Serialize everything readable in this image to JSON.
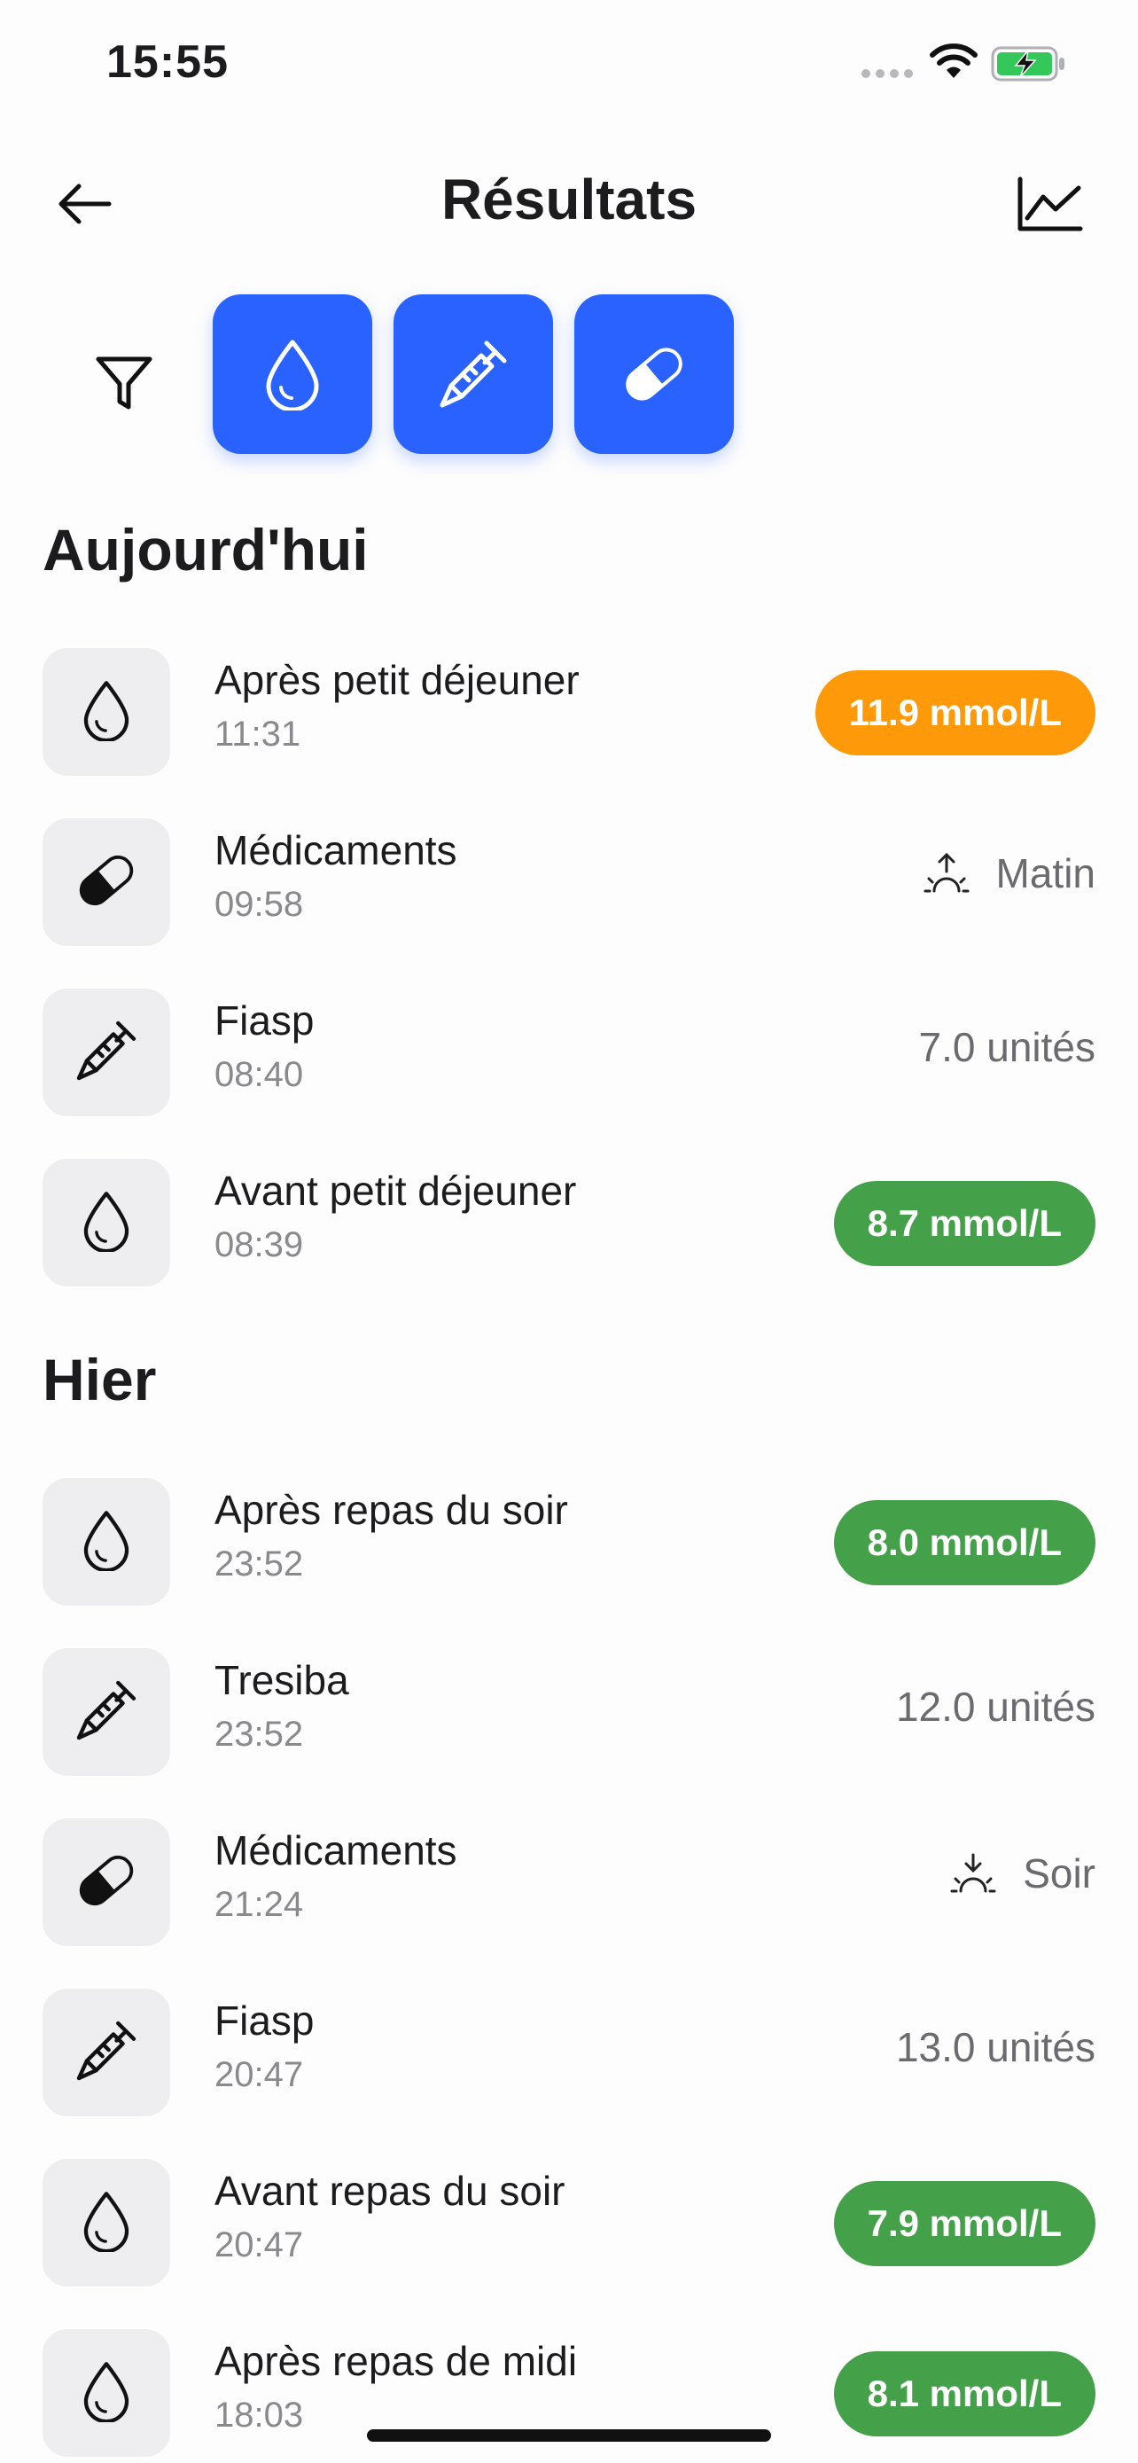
{
  "status_bar": {
    "time": "15:55"
  },
  "header": {
    "title": "Résultats"
  },
  "sections": {
    "today": {
      "title": "Aujourd'hui",
      "rows": [
        {
          "type": "glucose",
          "icon": "drop-icon",
          "title": "Après petit déjeuner",
          "time": "11:31",
          "value": "11.9 mmol/L",
          "status": "orange"
        },
        {
          "type": "medication",
          "icon": "pill-icon",
          "title": "Médicaments",
          "time": "09:58",
          "value": "Matin",
          "value_icon": "sunrise-icon"
        },
        {
          "type": "insulin",
          "icon": "syringe-icon",
          "title": "Fiasp",
          "time": "08:40",
          "value": "7.0 unités"
        },
        {
          "type": "glucose",
          "icon": "drop-icon",
          "title": "Avant petit déjeuner",
          "time": "08:39",
          "value": "8.7 mmol/L",
          "status": "green"
        }
      ]
    },
    "yesterday": {
      "title": "Hier",
      "rows": [
        {
          "type": "glucose",
          "icon": "drop-icon",
          "title": "Après repas du soir",
          "time": "23:52",
          "value": "8.0 mmol/L",
          "status": "green"
        },
        {
          "type": "insulin",
          "icon": "syringe-icon",
          "title": "Tresiba",
          "time": "23:52",
          "value": "12.0 unités"
        },
        {
          "type": "medication",
          "icon": "pill-icon",
          "title": "Médicaments",
          "time": "21:24",
          "value": "Soir",
          "value_icon": "sunset-icon"
        },
        {
          "type": "insulin",
          "icon": "syringe-icon",
          "title": "Fiasp",
          "time": "20:47",
          "value": "13.0 unités"
        },
        {
          "type": "glucose",
          "icon": "drop-icon",
          "title": "Avant repas du soir",
          "time": "20:47",
          "value": "7.9 mmol/L",
          "status": "green"
        },
        {
          "type": "glucose",
          "icon": "drop-icon",
          "title": "Après repas de midi",
          "time": "18:03",
          "value": "8.1 mmol/L",
          "status": "green"
        }
      ]
    }
  },
  "colors": {
    "accent": "#2962ff",
    "orange": "#fe9a0a",
    "green": "#45a04a",
    "battery": "#34c759"
  }
}
